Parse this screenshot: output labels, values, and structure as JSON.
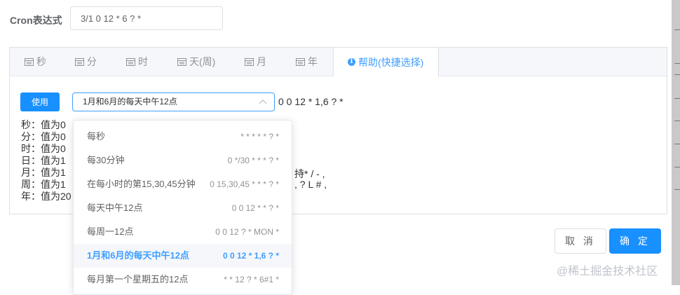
{
  "form": {
    "cron_label": "Cron表达式",
    "cron_value": "3/1 0 12 * 6 ? *"
  },
  "tabs": [
    {
      "label": "秒",
      "icon": "calendar-icon"
    },
    {
      "label": "分",
      "icon": "calendar-icon"
    },
    {
      "label": "时",
      "icon": "calendar-icon"
    },
    {
      "label": "天(周)",
      "icon": "calendar-icon"
    },
    {
      "label": "月",
      "icon": "calendar-icon"
    },
    {
      "label": "年",
      "icon": "calendar-icon"
    },
    {
      "label": "帮助(快捷选择)",
      "icon": "info-icon",
      "active": true
    }
  ],
  "help": {
    "use_button": "使用",
    "selected": "1月和6月的每天中午12点",
    "selected_expr": "0 0 12 * 1,6 ? *",
    "lines": [
      "秒：值为0",
      "分：值为0",
      "时：值为0",
      "日：值为1",
      "月：值为1",
      "周：值为1",
      "年：值为20"
    ],
    "fragments": {
      "month": "持* / - ,",
      "week": ", ? L # ,"
    }
  },
  "dropdown": {
    "options": [
      {
        "name": "每秒",
        "expr": "* * * * * ? *"
      },
      {
        "name": "每30分钟",
        "expr": "0 */30 * * * ? *"
      },
      {
        "name": "在每小时的第15,30,45分钟",
        "expr": "0 15,30,45 * * * ? *"
      },
      {
        "name": "每天中午12点",
        "expr": "0 0 12 * * ? *"
      },
      {
        "name": "每周一12点",
        "expr": "0 0 12 ? * MON *"
      },
      {
        "name": "1月和6月的每天中午12点",
        "expr": "0 0 12 * 1,6 ? *"
      },
      {
        "name": "每月第一个星期五的12点",
        "expr": "* * 12 ? * 6#1 *"
      }
    ]
  },
  "footer": {
    "cancel": "取 消",
    "ok": "确 定"
  },
  "watermark": "@稀土掘金技术社区",
  "colors": {
    "primary": "#1890ff",
    "accent": "#409eff",
    "border": "#dcdfe6"
  }
}
